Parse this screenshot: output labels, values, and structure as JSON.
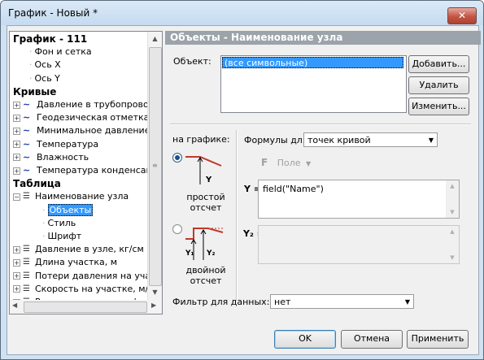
{
  "window": {
    "title": "График - Новый *",
    "close_label": "✕"
  },
  "tree": {
    "root": "График - 111",
    "root_children": [
      "Фон и сетка",
      "Ось X",
      "Ось Y"
    ],
    "curves_group": "Кривые",
    "curves": [
      "Давление в трубопрово",
      "Геодезическая отметка",
      "Минимальное давление",
      "Температура",
      "Влажность",
      "Температура конденсац"
    ],
    "table_group": "Таблица",
    "table_node": "Наименование узла",
    "table_node_children": [
      "Объекты",
      "Стиль",
      "Шрифт"
    ],
    "table_items": [
      "Давление в узле, кг/см",
      "Длина участка, м",
      "Потери давления на уча",
      "Скорость на участке, м/",
      "Расход на участке, т/ч"
    ]
  },
  "panel": {
    "header": "Объекты - Наименование узла",
    "object_label": "Объект:",
    "object_list": [
      "(все символьные)"
    ],
    "add_button": "Добавить...",
    "delete_button": "Удалить",
    "edit_button": "Изменить...",
    "on_graph_label": "на графике:",
    "formulas_label": "Формулы для:",
    "formulas_value": "точек кривой",
    "field_button": "Поле",
    "field_icon": "F",
    "y_label": "Y =",
    "y_formula": "field(\"Name\")",
    "y2_label": "Y₂ =",
    "y2_formula": "",
    "simple_caption": "простой\nотсчет",
    "double_caption": "двойной\nотсчет",
    "diagram_y": "Y",
    "diagram_y1": "Y₁",
    "diagram_y2": "Y₂",
    "filter_label": "Фильтр для данных:",
    "filter_value": "нет"
  },
  "footer": {
    "ok": "OK",
    "cancel": "Отмена",
    "apply": "Применить"
  },
  "colors": {
    "header_bg": "#9ca3aa",
    "selection": "#3399ff",
    "diagram_red": "#c0392b",
    "curve_icon": "#1c3fa8"
  }
}
